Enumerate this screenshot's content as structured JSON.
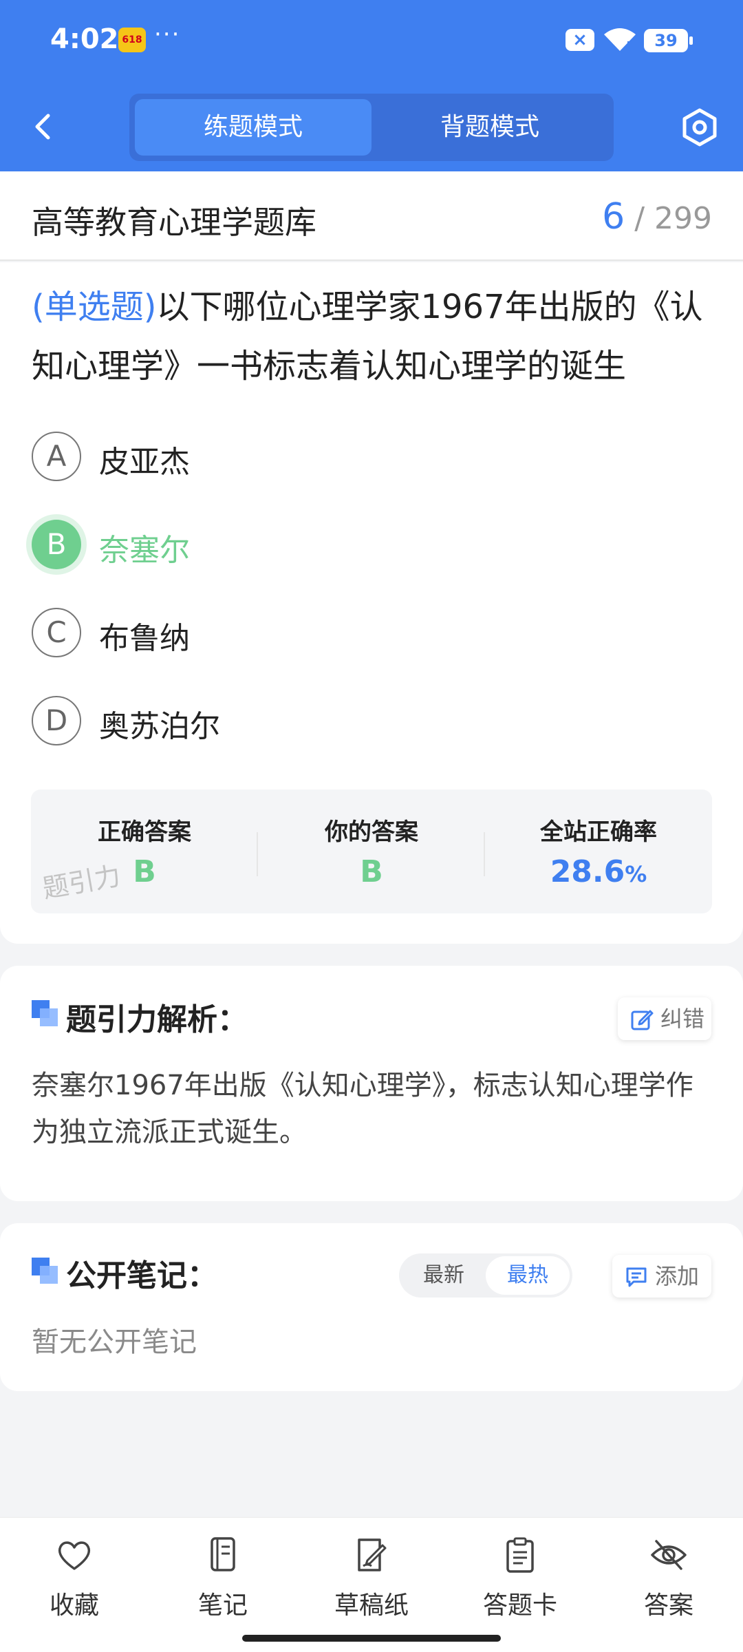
{
  "status_bar": {
    "time": "4:02",
    "app_badge": "618",
    "more": "···",
    "battery": "39"
  },
  "header": {
    "mode_tabs": [
      {
        "label": "练题模式",
        "active": true
      },
      {
        "label": "背题模式",
        "active": false
      }
    ]
  },
  "title_row": {
    "bank_title": "高等教育心理学题库",
    "current": "6",
    "separator": "/",
    "total": "299"
  },
  "question": {
    "type_label": "(单选题)",
    "text": "以下哪位心理学家1967年出版的《认知心理学》一书标志着认知心理学的诞生",
    "options": [
      {
        "letter": "A",
        "text": "皮亚杰",
        "state": "normal"
      },
      {
        "letter": "B",
        "text": "奈塞尔",
        "state": "correct"
      },
      {
        "letter": "C",
        "text": "布鲁纳",
        "state": "normal"
      },
      {
        "letter": "D",
        "text": "奥苏泊尔",
        "state": "normal"
      }
    ]
  },
  "stats": {
    "correct_label": "正确答案",
    "correct_value": "B",
    "yours_label": "你的答案",
    "yours_value": "B",
    "rate_label": "全站正确率",
    "rate_value": "28.6",
    "rate_unit": "%",
    "watermark": "题引力"
  },
  "analysis": {
    "title": "题引力解析：",
    "report_label": "纠错",
    "text": "奈塞尔1967年出版《认知心理学》，标志认知心理学作为独立流派正式诞生。"
  },
  "notes": {
    "title": "公开笔记：",
    "sort_options": [
      "最新",
      "最热"
    ],
    "sort_selected": "最热",
    "add_label": "添加",
    "empty_text": "暂无公开笔记"
  },
  "bottom_nav": [
    {
      "label": "收藏",
      "icon": "heart-icon"
    },
    {
      "label": "笔记",
      "icon": "notebook-icon"
    },
    {
      "label": "草稿纸",
      "icon": "draft-icon"
    },
    {
      "label": "答题卡",
      "icon": "clipboard-icon"
    },
    {
      "label": "答案",
      "icon": "eye-off-icon"
    }
  ],
  "colors": {
    "primary": "#3f7ff0",
    "correct": "#6fcf8f",
    "background": "#f3f4f6"
  }
}
